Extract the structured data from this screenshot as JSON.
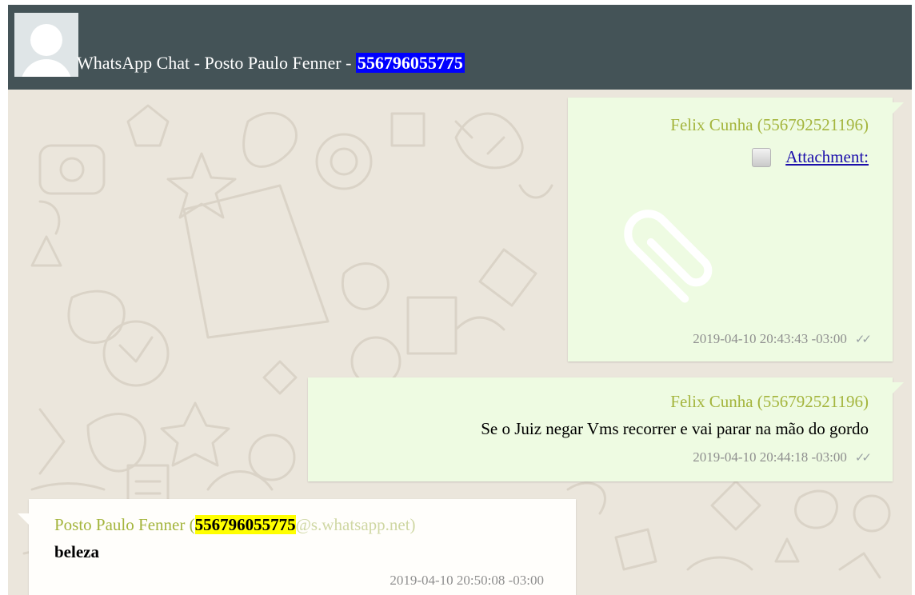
{
  "header": {
    "title_prefix": "WhatsApp Chat - Posto Paulo Fenner - ",
    "title_number": "556796055775"
  },
  "messages": [
    {
      "sender": "Felix Cunha (556792521196)",
      "attachment_label": "Attachment:",
      "attachment_icon": "paperclip-icon",
      "timestamp": "2019-04-10 20:43:43 -03:00",
      "ticks": "✓✓"
    },
    {
      "sender": "Felix Cunha (556792521196)",
      "text": "Se o Juiz negar Vms recorrer e vai parar na mão do gordo",
      "timestamp": "2019-04-10 20:44:18 -03:00",
      "ticks": "✓✓"
    },
    {
      "sender_prefix": "Posto Paulo Fenner (",
      "sender_number": "556796055775",
      "sender_suffix": "@s.whatsapp.net)",
      "text": "beleza",
      "timestamp": "2019-04-10 20:50:08 -03:00"
    }
  ],
  "colors": {
    "header_bg": "#445357",
    "title_highlight": "#0000ff",
    "number_highlight": "#ffff00",
    "outgoing_bubble": "#eefbe2",
    "incoming_bubble": "#fffefb",
    "sender_name": "#a4b53d"
  }
}
